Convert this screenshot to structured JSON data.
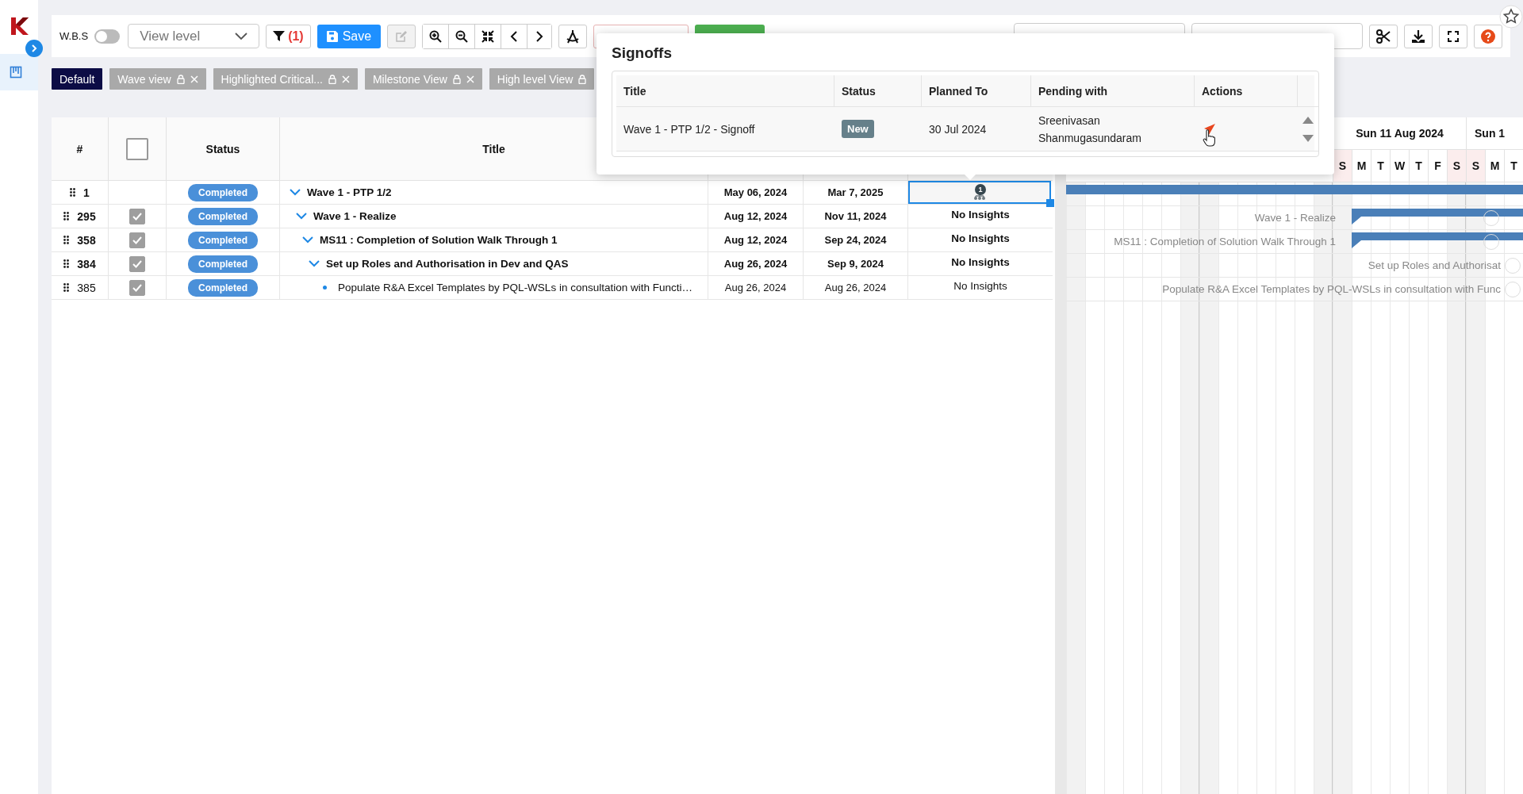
{
  "sidebar": {
    "items": [
      {
        "selected": true
      }
    ]
  },
  "toolbar": {
    "wbs_toggle": {
      "label": "W.B.S",
      "on": false
    },
    "view_level": {
      "placeholder": "View level"
    },
    "filter": {
      "count": "(1)"
    },
    "save": {
      "label": "Save"
    },
    "edit": {
      "disabled": true
    }
  },
  "saved_views": [
    {
      "label": "Default",
      "selected": true,
      "locked": false,
      "closable": false
    },
    {
      "label": "Wave view",
      "selected": false,
      "locked": true,
      "closable": true
    },
    {
      "label": "Highlighted Critical...",
      "selected": false,
      "locked": true,
      "closable": true
    },
    {
      "label": "Milestone View",
      "selected": false,
      "locked": true,
      "closable": true
    },
    {
      "label": "High level View",
      "selected": false,
      "locked": true,
      "closable": false
    }
  ],
  "table": {
    "columns": [
      "#",
      "Status",
      "Title"
    ],
    "select_all": {
      "checked": false
    },
    "rows": [
      {
        "id": "1",
        "status": "Completed",
        "title": "Wave 1 - PTP 1/2",
        "kind": "group",
        "expanded": true,
        "start": "May 06, 2024",
        "end": "Mar 7, 2025",
        "insights": {
          "kind": "icon",
          "count": "1",
          "selected": true
        },
        "children": [
          {
            "id": "295",
            "checked": true,
            "status": "Completed",
            "title": "Wave 1 - Realize",
            "kind": "group",
            "expanded": true,
            "start": "Aug 12, 2024",
            "end": "Nov 11, 2024",
            "insights": {
              "kind": "text",
              "text": "No Insights"
            },
            "children": [
              {
                "id": "358",
                "checked": true,
                "status": "Completed",
                "title": "MS11 : Completion of Solution Walk Through 1",
                "kind": "group",
                "expanded": true,
                "start": "Aug 12, 2024",
                "end": "Sep 24, 2024",
                "insights": {
                  "kind": "text",
                  "text": "No Insights"
                },
                "children": [
                  {
                    "id": "384",
                    "checked": true,
                    "status": "Completed",
                    "title": "Set up Roles and Authorisation in Dev and QAS",
                    "kind": "group",
                    "expanded": true,
                    "start": "Aug 26, 2024",
                    "end": "Sep 9, 2024",
                    "insights": {
                      "kind": "text",
                      "text": "No Insights"
                    },
                    "children": [
                      {
                        "id": "385",
                        "checked": true,
                        "status": "Completed",
                        "title": "Populate R&A Excel Templates by PQL-WSLs in consultation with Functi…",
                        "kind": "task",
                        "start": "Aug 26, 2024",
                        "end": "Aug 26, 2024",
                        "insights": {
                          "kind": "text",
                          "text": "No Insights"
                        }
                      }
                    ]
                  }
                ]
              }
            ]
          }
        ]
      }
    ]
  },
  "gantt": {
    "weeks": [
      "Sun 11 Aug 2024",
      "Sun 1"
    ],
    "days": [
      {
        "label": "S",
        "weekend": true
      },
      {
        "label": "M",
        "weekend": false
      },
      {
        "label": "T",
        "weekend": false
      },
      {
        "label": "W",
        "weekend": false
      },
      {
        "label": "T",
        "weekend": false
      },
      {
        "label": "F",
        "weekend": false
      },
      {
        "label": "S",
        "weekend": true
      },
      {
        "label": "S",
        "weekend": true
      },
      {
        "label": "M",
        "weekend": false
      },
      {
        "label": "T",
        "weekend": false
      }
    ],
    "rows": [
      {
        "kind": "full",
        "marker": false
      },
      {
        "kind": "summary",
        "label": "Wave 1 - Realize",
        "marker": true
      },
      {
        "kind": "summary",
        "label": "MS11 : Completion of Solution Walk Through 1",
        "marker": true
      },
      {
        "kind": "label",
        "label": "Set up Roles and Authorisat",
        "marker": true
      },
      {
        "kind": "label",
        "label": "Populate R&A Excel Templates by PQL-WSLs in consultation with Func",
        "marker": true
      }
    ]
  },
  "signoffs_popup": {
    "title": "Signoffs",
    "columns": [
      "Title",
      "Status",
      "Planned To",
      "Pending with",
      "Actions"
    ],
    "rows": [
      {
        "title": "Wave 1 - PTP 1/2 - Signoff",
        "status": "New",
        "planned_to": "30 Jul 2024",
        "pending_with": "Sreenivasan Shanmugasundaram"
      }
    ]
  }
}
